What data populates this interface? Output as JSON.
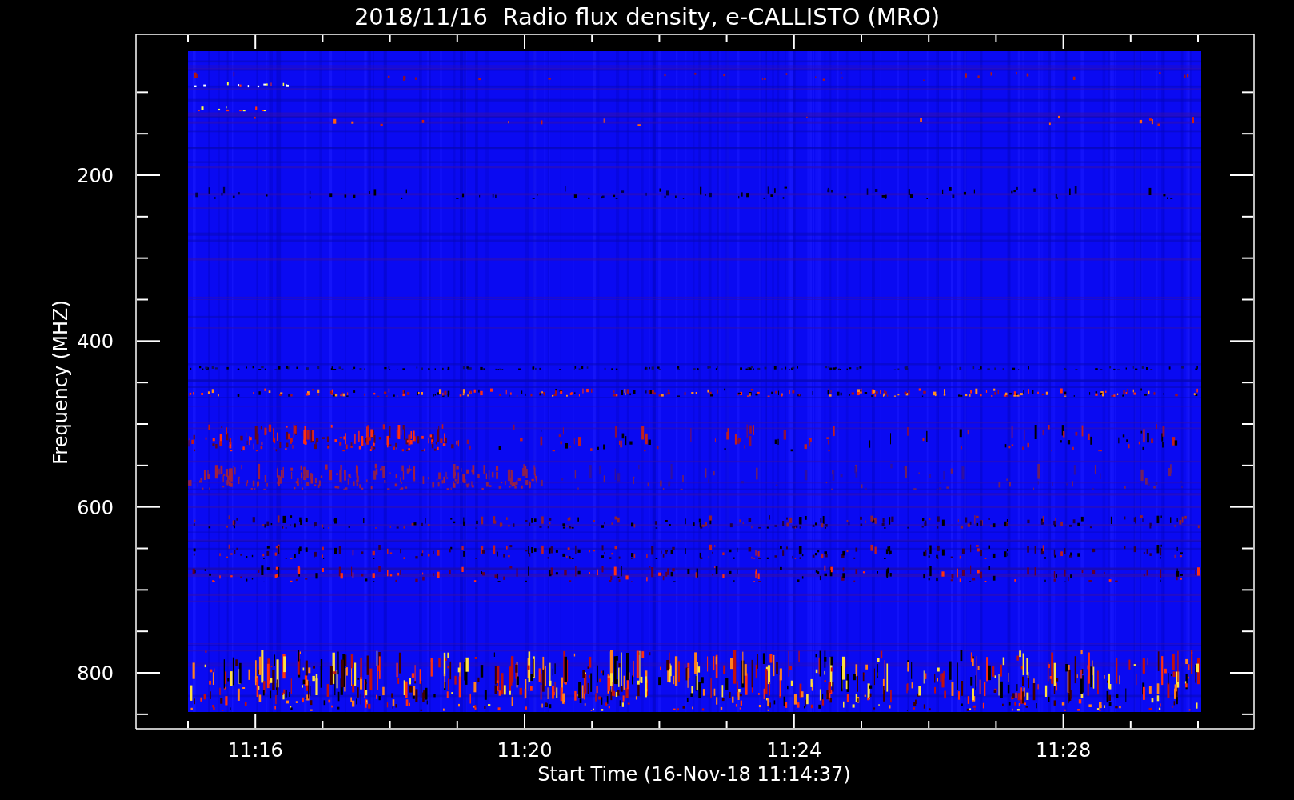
{
  "title": "2018/11/16  Radio flux density, e-CALLISTO (MRO)",
  "x_axis": {
    "label": "Start Time (16-Nov-18 11:14:37)",
    "ticks": [
      "11:16",
      "11:20",
      "11:24",
      "11:28"
    ]
  },
  "y_axis": {
    "label": "Frequency (MHZ)",
    "ticks": [
      "200",
      "400",
      "600",
      "800"
    ]
  }
}
